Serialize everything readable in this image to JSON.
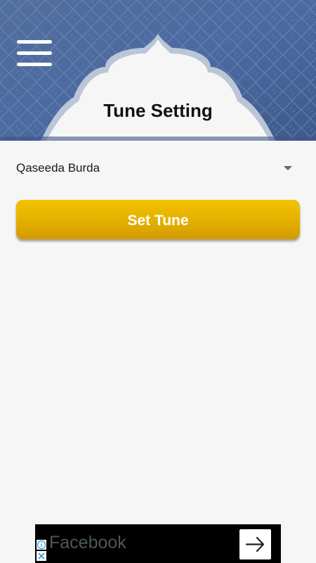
{
  "header": {
    "title": "Tune Setting",
    "menu_icon": "hamburger-menu-icon",
    "colors": {
      "pattern_blue": "#4a6fa5",
      "pattern_dark": "#3e5a8a",
      "dome_fill": "#f6f6f6"
    }
  },
  "tune_select": {
    "selected": "Qaseeda Burda",
    "caret_icon": "dropdown-caret-icon"
  },
  "set_button": {
    "label": "Set Tune",
    "color": "#e6b300"
  },
  "ad": {
    "text": "Facebook",
    "arrow_icon": "arrow-right-icon",
    "info_icon": "info-icon",
    "close_icon": "close-icon"
  }
}
